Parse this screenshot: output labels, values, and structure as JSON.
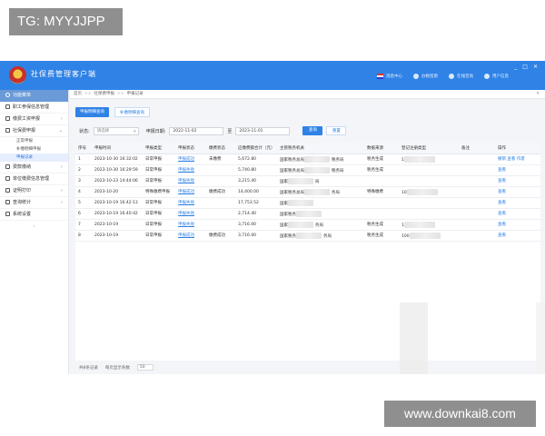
{
  "watermarks": {
    "top": "TG: MYYJJPP",
    "bottom": "www.downkai8.com"
  },
  "app": {
    "title": "社保费管理客户端",
    "topbar": [
      "消息中心",
      "办税指南",
      "在线咨询",
      "用户信息"
    ],
    "window_controls": [
      "_",
      "□",
      "✕"
    ]
  },
  "sidebar": {
    "header": "功能菜单",
    "items": [
      {
        "label": "职工参保信息管理",
        "chevron": ""
      },
      {
        "label": "缴费工资申报",
        "chevron": "›"
      },
      {
        "label": "社保费申报",
        "chevron": "⌄",
        "sub": [
          "正常申报",
          "补缴明细申报",
          "申报记录"
        ]
      },
      {
        "label": "费款缴纳",
        "chevron": "›"
      },
      {
        "label": "单位缴费信息管理",
        "chevron": ""
      },
      {
        "label": "证明打印",
        "chevron": "›"
      },
      {
        "label": "查询统计",
        "chevron": "›"
      },
      {
        "label": "系统设置",
        "chevron": ""
      }
    ],
    "sep": "‹"
  },
  "breadcrumb": [
    "首页",
    ">>",
    "社保费申报",
    ">>",
    "申报记录"
  ],
  "tabs": {
    "active": "申报明细查询",
    "inactive": "补缴明细查询"
  },
  "filters": {
    "status_label": "状态:",
    "status_value": "请选择",
    "date_label": "申报日期:",
    "date_from": "2022-11-02",
    "date_to_label": "至",
    "date_to": "2023-11-01",
    "query": "查询",
    "reset": "重置"
  },
  "table": {
    "headers": [
      "序号",
      "申报时间",
      "申报类型",
      "申报状态",
      "缴费状态",
      "应缴费额合计（元）",
      "主管税务机关",
      "数据来源",
      "登记注册类型",
      "备注",
      "操作"
    ],
    "rows": [
      {
        "seq": "1",
        "time": "2023-10-30 16:32:02",
        "type": "日常申报",
        "status": "申报成功",
        "pay": "未缴费",
        "amount": "5,672.80",
        "org": "国家税务总局",
        "org2": "税务局",
        "src": "税务生成",
        "reg": "1",
        "ops": "撤销 查看 作废"
      },
      {
        "seq": "2",
        "time": "2023-10-30 16:29:59",
        "type": "日常申报",
        "status": "申报失败",
        "pay": "",
        "amount": "5,740.80",
        "org": "国家税务总局",
        "org2": "税务局",
        "src": "税务生成",
        "reg": "",
        "ops": "查看"
      },
      {
        "seq": "3",
        "time": "2023-10-23 14:44:06",
        "type": "日常申报",
        "status": "申报失败",
        "pay": "",
        "amount": "3,215.40",
        "org": "国家",
        "org2": "局",
        "src": "",
        "reg": "",
        "ops": "查看"
      },
      {
        "seq": "4",
        "time": "2023-10-20",
        "type": "特殊缴费申报",
        "status": "申报成功",
        "pay": "缴费成功",
        "amount": "14,400.00",
        "org": "国家税务总局",
        "org2": "务局",
        "src": "特殊缴费",
        "reg": "10",
        "ops": "查看"
      },
      {
        "seq": "5",
        "time": "2023-10-19 16:42:13",
        "type": "日常申报",
        "status": "申报失败",
        "pay": "",
        "amount": "17,753.52",
        "org": "国家",
        "org2": "",
        "src": "",
        "reg": "",
        "ops": "查看"
      },
      {
        "seq": "6",
        "time": "2023-10-19 16:40:42",
        "type": "日常申报",
        "status": "申报失败",
        "pay": "",
        "amount": "2,714.40",
        "org": "国家税务",
        "org2": "",
        "src": "",
        "reg": "",
        "ops": "查看"
      },
      {
        "seq": "7",
        "time": "2023-10-19",
        "type": "日常申报",
        "status": "申报失败",
        "pay": "",
        "amount": "3,716.00",
        "org": "国家",
        "org2": "务局",
        "src": "税务生成",
        "reg": "1",
        "ops": "查看"
      },
      {
        "seq": "8",
        "time": "2023-10-19",
        "type": "日常申报",
        "status": "申报成功",
        "pay": "缴费成功",
        "amount": "3,716.00",
        "org": "国家税务",
        "org2": "务局",
        "src": "税务生成",
        "reg": "100",
        "ops": "查看"
      }
    ]
  },
  "pager": {
    "summary": "共8条记录",
    "per_page_label": "每页显示条数",
    "per_page": "50"
  }
}
